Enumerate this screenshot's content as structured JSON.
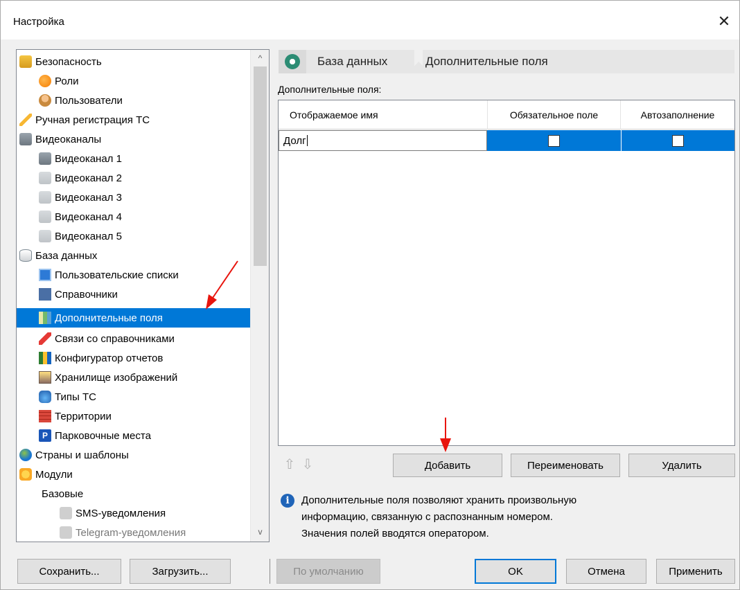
{
  "window": {
    "title": "Настройка",
    "close_symbol": "✕"
  },
  "tree": {
    "items": [
      {
        "label": "Безопасность",
        "icon": "lock-icon"
      },
      {
        "label": "Роли",
        "icon": "roles-icon"
      },
      {
        "label": "Пользователи",
        "icon": "users-icon"
      },
      {
        "label": "Ручная регистрация ТС",
        "icon": "pencil-icon"
      },
      {
        "label": "Видеоканалы",
        "icon": "camera-icon"
      },
      {
        "label": "Видеоканал 1",
        "icon": "camera-icon"
      },
      {
        "label": "Видеоканал 2",
        "icon": "camera-icon"
      },
      {
        "label": "Видеоканал 3",
        "icon": "camera-icon"
      },
      {
        "label": "Видеоканал 4",
        "icon": "camera-icon"
      },
      {
        "label": "Видеоканал 5",
        "icon": "camera-icon"
      },
      {
        "label": "База данных",
        "icon": "database-icon"
      },
      {
        "label": "Пользовательские списки",
        "icon": "list-icon"
      },
      {
        "label": "Справочники",
        "icon": "book-icon"
      },
      {
        "label": "Дополнительные поля",
        "icon": "fields-icon"
      },
      {
        "label": "Связи со справочниками",
        "icon": "link-icon"
      },
      {
        "label": "Конфигуратор отчетов",
        "icon": "chart-icon"
      },
      {
        "label": "Хранилище изображений",
        "icon": "image-icon"
      },
      {
        "label": "Типы ТС",
        "icon": "car-icon"
      },
      {
        "label": "Территории",
        "icon": "brick-icon"
      },
      {
        "label": "Парковочные места",
        "icon": "parking-icon",
        "glyph": "P"
      },
      {
        "label": "Страны и шаблоны",
        "icon": "globe-icon"
      },
      {
        "label": "Модули",
        "icon": "puzzle-icon"
      },
      {
        "label": "Базовые",
        "icon": ""
      },
      {
        "label": "SMS-уведомления",
        "icon": "sms-icon"
      },
      {
        "label": "Telegram-уведомления",
        "icon": "sms-icon"
      }
    ],
    "selected": "Дополнительные поля",
    "scroll_up": "^",
    "scroll_down": "v"
  },
  "breadcrumb": {
    "items": [
      "База данных",
      "Дополнительные поля"
    ]
  },
  "fields": {
    "label": "Дополнительные поля:",
    "columns": [
      "Отображаемое имя",
      "Обязательное поле",
      "Автозаполнение"
    ],
    "rows": [
      {
        "name": "Долг",
        "required": false,
        "autofill": false
      }
    ]
  },
  "buttons": {
    "up_arrow": "⇧",
    "down_arrow": "⇩",
    "add": "Добавить",
    "rename": "Переименовать",
    "delete": "Удалить",
    "save": "Сохранить...",
    "load": "Загрузить...",
    "defaults": "По умолчанию",
    "ok": "OK",
    "cancel": "Отмена",
    "apply": "Применить"
  },
  "info": {
    "icon_glyph": "i",
    "lines": [
      "Дополнительные поля позволяют хранить произвольную",
      "информацию, связанную с распознанным номером.",
      "Значения полей вводятся оператором."
    ]
  },
  "colors": {
    "selection": "#0078d7",
    "annotation_arrow": "#e8140d"
  }
}
